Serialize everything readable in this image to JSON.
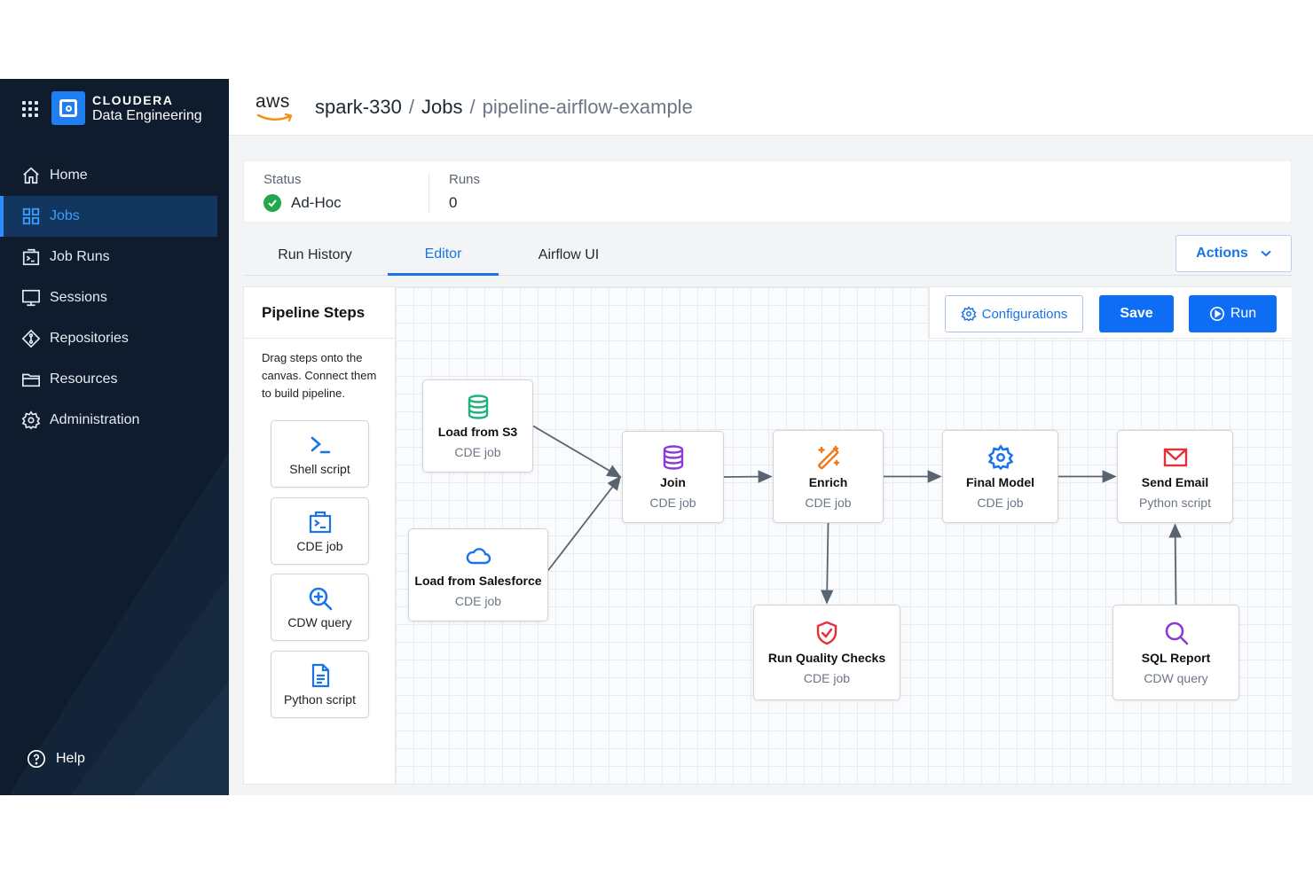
{
  "brand": {
    "name": "CLOUDERA",
    "product": "Data Engineering"
  },
  "nav": {
    "items": [
      {
        "label": "Home",
        "icon": "home-icon"
      },
      {
        "label": "Jobs",
        "icon": "grid-icon",
        "active": true
      },
      {
        "label": "Job Runs",
        "icon": "terminal-icon"
      },
      {
        "label": "Sessions",
        "icon": "monitor-icon"
      },
      {
        "label": "Repositories",
        "icon": "diamond-icon"
      },
      {
        "label": "Resources",
        "icon": "folder-icon"
      },
      {
        "label": "Administration",
        "icon": "gear-icon"
      }
    ],
    "help": "Help"
  },
  "header": {
    "provider": "aws",
    "breadcrumb": [
      "spark-330",
      "Jobs",
      "pipeline-airflow-example"
    ]
  },
  "status": {
    "status_label": "Status",
    "status_value": "Ad-Hoc",
    "runs_label": "Runs",
    "runs_value": "0"
  },
  "tabs": [
    {
      "label": "Run History"
    },
    {
      "label": "Editor",
      "active": true
    },
    {
      "label": "Airflow UI"
    }
  ],
  "actions_label": "Actions",
  "steps_panel": {
    "title": "Pipeline Steps",
    "description": "Drag steps onto the canvas. Connect them to build pipeline.",
    "tiles": [
      {
        "label": "Shell script",
        "icon": "terminal-prompt-icon"
      },
      {
        "label": "CDE job",
        "icon": "cde-job-icon"
      },
      {
        "label": "CDW query",
        "icon": "search-query-icon"
      },
      {
        "label": "Python script",
        "icon": "document-icon"
      }
    ]
  },
  "toolbar": {
    "configurations": "Configurations",
    "save": "Save",
    "run": "Run"
  },
  "pipeline": {
    "nodes": [
      {
        "id": "load-s3",
        "title": "Load from S3",
        "type": "CDE job",
        "icon": "database-icon",
        "color": "#1db37a"
      },
      {
        "id": "load-salesforce",
        "title": "Load from Salesforce",
        "type": "CDE job",
        "icon": "cloud-icon",
        "color": "#1a73e8"
      },
      {
        "id": "join",
        "title": "Join",
        "type": "CDE job",
        "icon": "database-icon",
        "color": "#8a3ad6"
      },
      {
        "id": "enrich",
        "title": "Enrich",
        "type": "CDE job",
        "icon": "magic-wand-icon",
        "color": "#f07a1a"
      },
      {
        "id": "final-model",
        "title": "Final Model",
        "type": "CDE job",
        "icon": "gear-icon",
        "color": "#1a73e8"
      },
      {
        "id": "send-email",
        "title": "Send Email",
        "type": "Python script",
        "icon": "mail-icon",
        "color": "#e5303a"
      },
      {
        "id": "quality",
        "title": "Run Quality Checks",
        "type": "CDE job",
        "icon": "shield-check-icon",
        "color": "#e5303a"
      },
      {
        "id": "sql-report",
        "title": "SQL Report",
        "type": "CDW query",
        "icon": "search-icon",
        "color": "#8a3ad6"
      }
    ],
    "edges": [
      [
        "load-s3",
        "join"
      ],
      [
        "load-salesforce",
        "join"
      ],
      [
        "join",
        "enrich"
      ],
      [
        "enrich",
        "final-model"
      ],
      [
        "final-model",
        "send-email"
      ],
      [
        "enrich",
        "quality"
      ],
      [
        "sql-report",
        "send-email"
      ]
    ]
  },
  "colors": {
    "sidebar": "#0f1c2e",
    "accent": "#1a73e8",
    "success": "#21a84a",
    "primary_button": "#0d6ef5"
  }
}
